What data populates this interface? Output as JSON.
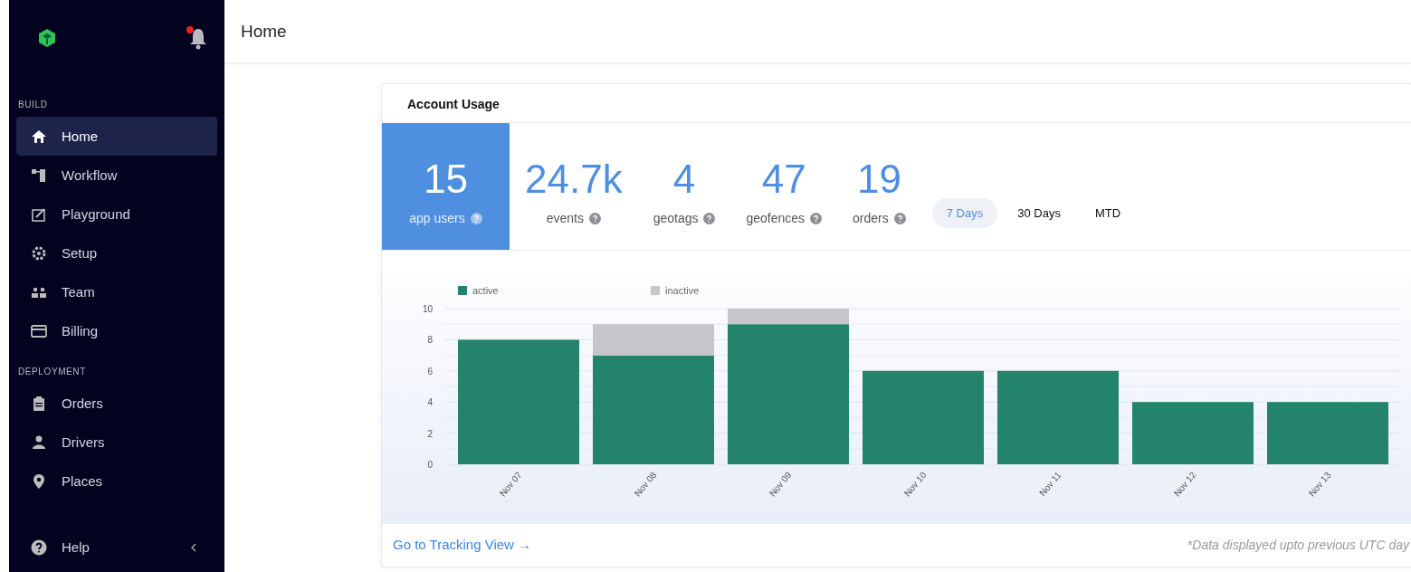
{
  "sidebar": {
    "notification_dot": true,
    "sections": [
      {
        "title": "BUILD",
        "items": [
          {
            "label": "Home",
            "selected": true
          },
          {
            "label": "Workflow",
            "selected": false
          },
          {
            "label": "Playground",
            "selected": false
          },
          {
            "label": "Setup",
            "selected": false
          },
          {
            "label": "Team",
            "selected": false
          },
          {
            "label": "Billing",
            "selected": false
          }
        ]
      },
      {
        "title": "DEPLOYMENT",
        "items": [
          {
            "label": "Orders",
            "selected": false
          },
          {
            "label": "Drivers",
            "selected": false
          },
          {
            "label": "Places",
            "selected": false
          }
        ]
      }
    ],
    "help": "Help"
  },
  "header": {
    "title": "Home"
  },
  "card": {
    "title": "Account Usage",
    "stats": [
      {
        "value": "15",
        "label": "app users",
        "selected": true
      },
      {
        "value": "24.7k",
        "label": "events",
        "selected": false
      },
      {
        "value": "4",
        "label": "geotags",
        "selected": false
      },
      {
        "value": "47",
        "label": "geofences",
        "selected": false
      },
      {
        "value": "19",
        "label": "orders",
        "selected": false
      }
    ],
    "ranges": [
      {
        "label": "7 Days",
        "selected": true
      },
      {
        "label": "30 Days",
        "selected": false
      },
      {
        "label": "MTD",
        "selected": false
      }
    ],
    "chart_data": {
      "type": "bar",
      "stacked": true,
      "grid": true,
      "legend": true,
      "categories": [
        "Nov 07",
        "Nov 08",
        "Nov 09",
        "Nov 10",
        "Nov 11",
        "Nov 12",
        "Nov 13"
      ],
      "ylim": [
        0,
        10
      ],
      "yticks": [
        0,
        2,
        4,
        6,
        8,
        10
      ],
      "series": [
        {
          "name": "active",
          "color": "#23836d",
          "values": [
            8,
            7,
            9,
            6,
            6,
            4,
            4
          ]
        },
        {
          "name": "inactive",
          "color": "#c6c5cb",
          "values": [
            0,
            2,
            1,
            0,
            0,
            0,
            0
          ]
        }
      ]
    },
    "link": "Go to Tracking View →",
    "note": "*Data displayed upto previous UTC day"
  }
}
